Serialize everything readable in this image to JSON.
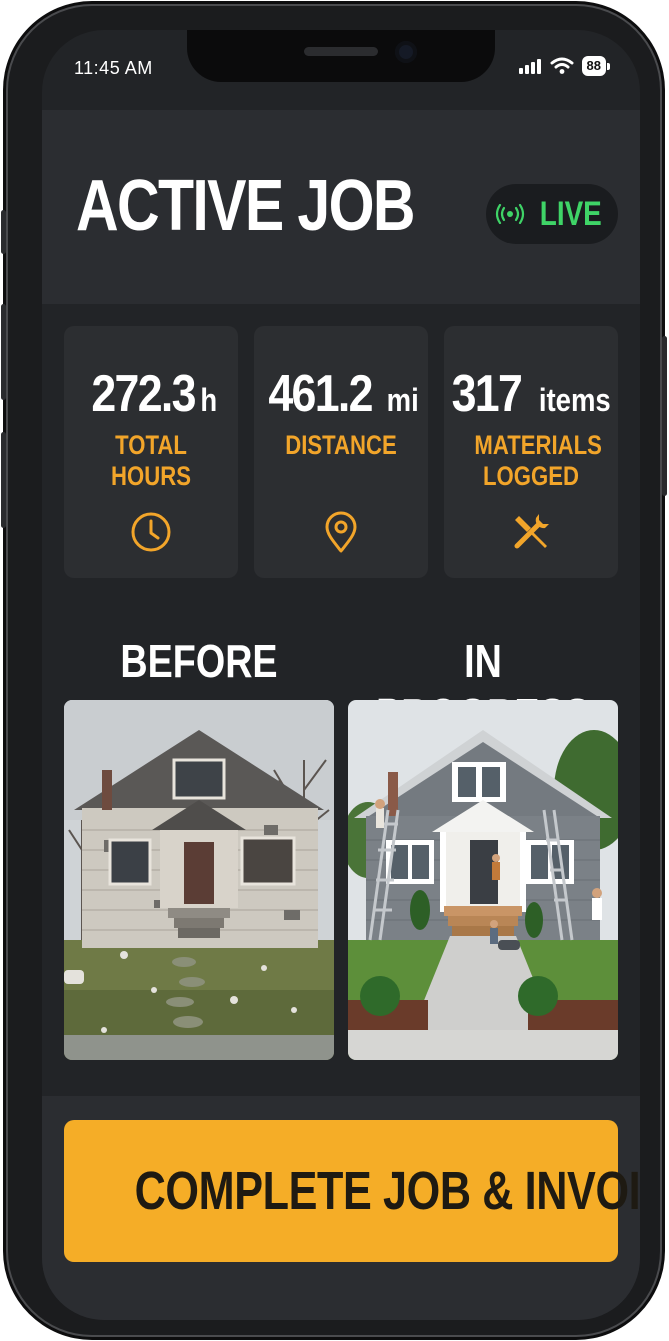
{
  "status_bar": {
    "time": "11:45 AM",
    "battery": "88"
  },
  "header": {
    "title": "ACTIVE JOB",
    "live_label": "LIVE"
  },
  "colors": {
    "accent": "#f5ad27",
    "live": "#3fd467",
    "background": "#222427",
    "card": "#2c2e31"
  },
  "stats": [
    {
      "value": "272.3",
      "unit": "h",
      "label": "TOTAL HOURS",
      "icon": "clock-icon"
    },
    {
      "value": "461.2",
      "unit": "mi",
      "label": "DISTANCE",
      "icon": "location-pin-icon"
    },
    {
      "value": "317",
      "unit": "items",
      "label": "MATERIALS LOGGED",
      "icon": "tools-icon"
    }
  ],
  "photos": {
    "before_label": "BEFORE",
    "progress_label": "IN PROGRESS"
  },
  "cta": {
    "label": "COMPLETE JOB & INVOICE"
  }
}
